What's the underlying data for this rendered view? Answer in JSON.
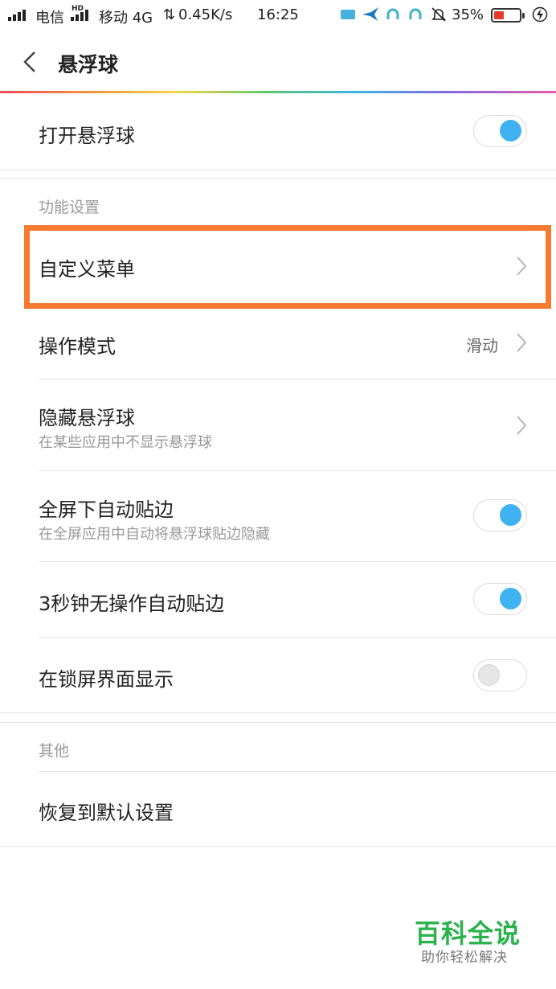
{
  "status_bar": {
    "carrier1": "电信",
    "hd_tag": "HD",
    "carrier2": "移动 4G",
    "speed": "0.45K/s",
    "time": "16:25",
    "battery_percent": "35%",
    "battery_level": 0.35,
    "battery_color": "#e83a2c"
  },
  "header": {
    "title": "悬浮球"
  },
  "settings": {
    "open_floating_ball": {
      "title": "打开悬浮球",
      "enabled": true
    },
    "section_function": "功能设置",
    "custom_menu": {
      "title": "自定义菜单"
    },
    "operation_mode": {
      "title": "操作模式",
      "value": "滑动"
    },
    "hide_floating_ball": {
      "title": "隐藏悬浮球",
      "subtitle": "在某些应用中不显示悬浮球"
    },
    "fullscreen_auto_edge": {
      "title": "全屏下自动贴边",
      "subtitle": "在全屏应用中自动将悬浮球贴边隐藏",
      "enabled": true
    },
    "idle_auto_edge": {
      "title": "3秒钟无操作自动贴边",
      "enabled": true
    },
    "show_on_lockscreen": {
      "title": "在锁屏界面显示",
      "enabled": false
    },
    "section_other": "其他",
    "restore_defaults": {
      "title": "恢复到默认设置"
    }
  },
  "watermark": {
    "main": "百科全说",
    "sub": "助你轻松解决"
  },
  "colors": {
    "toggle_on": "#3fb2f1",
    "highlight": "#f67a2f",
    "watermark": "#2bb24c"
  }
}
